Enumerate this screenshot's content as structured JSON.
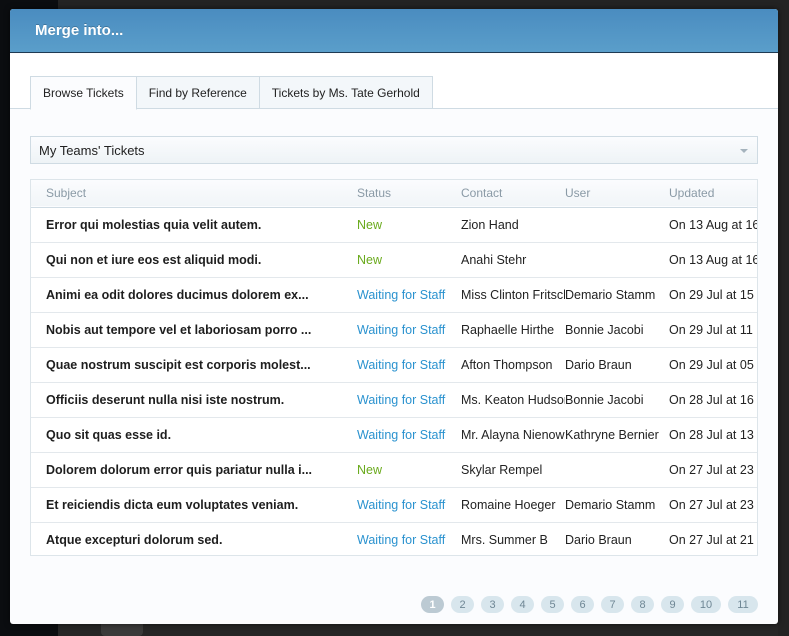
{
  "modal": {
    "title": "Merge into..."
  },
  "tabs": [
    {
      "label": "Browse Tickets",
      "active": true
    },
    {
      "label": "Find by Reference",
      "active": false
    },
    {
      "label": "Tickets by Ms. Tate Gerhold",
      "active": false
    }
  ],
  "filter": {
    "selected": "My Teams' Tickets"
  },
  "table": {
    "columns": [
      "Subject",
      "Status",
      "Contact",
      "User",
      "Updated"
    ],
    "rows": [
      {
        "subject": "Error qui molestias quia velit autem.",
        "status": "New",
        "contact": "Zion Hand",
        "user": "",
        "updated": "On 13 Aug at 16"
      },
      {
        "subject": "Qui non et iure eos est aliquid modi.",
        "status": "New",
        "contact": "Anahi Stehr",
        "user": "",
        "updated": "On 13 Aug at 16"
      },
      {
        "subject": "Animi ea odit dolores ducimus dolorem ex...",
        "status": "Waiting for Staff",
        "contact": "Miss Clinton Fritsch",
        "user": "Demario Stamm",
        "updated": "On 29 Jul at 15"
      },
      {
        "subject": "Nobis aut tempore vel et laboriosam porro ...",
        "status": "Waiting for Staff",
        "contact": "Raphaelle Hirthe",
        "user": "Bonnie Jacobi",
        "updated": "On 29 Jul at 11"
      },
      {
        "subject": "Quae nostrum suscipit est corporis molest...",
        "status": "Waiting for Staff",
        "contact": "Afton Thompson",
        "user": "Dario Braun",
        "updated": "On 29 Jul at 05"
      },
      {
        "subject": "Officiis deserunt nulla nisi iste nostrum.",
        "status": "Waiting for Staff",
        "contact": "Ms. Keaton Hudson",
        "user": "Bonnie Jacobi",
        "updated": "On 28 Jul at 16"
      },
      {
        "subject": "Quo sit quas esse id.",
        "status": "Waiting for Staff",
        "contact": "Mr. Alayna Nienow",
        "user": "Kathryne Bernier",
        "updated": "On 28 Jul at 13"
      },
      {
        "subject": "Dolorem dolorum error quis pariatur nulla i...",
        "status": "New",
        "contact": "Skylar Rempel",
        "user": "",
        "updated": "On 27 Jul at 23"
      },
      {
        "subject": "Et reiciendis dicta eum voluptates veniam.",
        "status": "Waiting for Staff",
        "contact": "Romaine Hoeger",
        "user": "Demario Stamm",
        "updated": "On 27 Jul at 23"
      },
      {
        "subject": "Atque excepturi dolorum sed.",
        "status": "Waiting for Staff",
        "contact": "Mrs. Summer B",
        "user": "Dario Braun",
        "updated": "On 27 Jul at 21"
      }
    ]
  },
  "status_colors": {
    "New": "#6aaa1c",
    "Waiting for Staff": "#2a92cf"
  },
  "pagination": {
    "current": 1,
    "pages": [
      "1",
      "2",
      "3",
      "4",
      "5",
      "6",
      "7",
      "8",
      "9",
      "10",
      "11"
    ]
  }
}
